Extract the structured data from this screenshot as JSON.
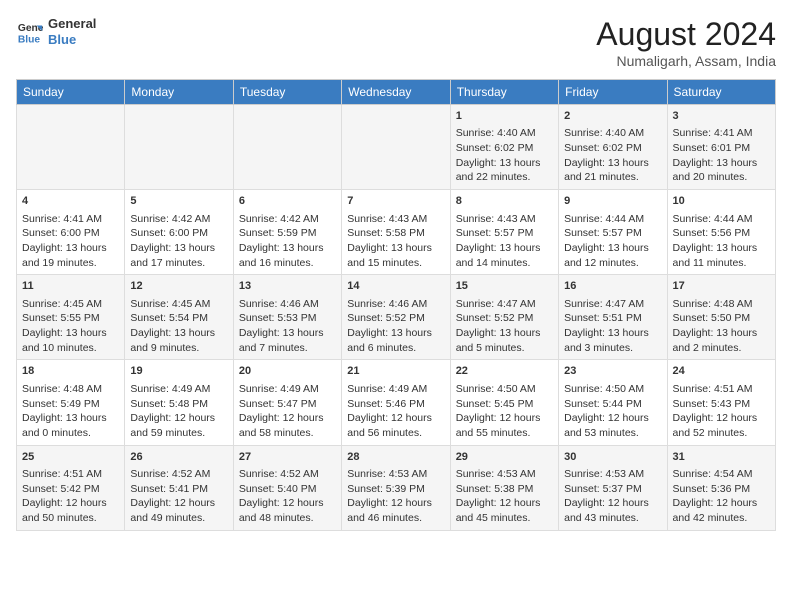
{
  "header": {
    "logo_line1": "General",
    "logo_line2": "Blue",
    "main_title": "August 2024",
    "sub_title": "Numaligarh, Assam, India"
  },
  "calendar": {
    "headers": [
      "Sunday",
      "Monday",
      "Tuesday",
      "Wednesday",
      "Thursday",
      "Friday",
      "Saturday"
    ],
    "rows": [
      [
        {
          "day": "",
          "info": ""
        },
        {
          "day": "",
          "info": ""
        },
        {
          "day": "",
          "info": ""
        },
        {
          "day": "",
          "info": ""
        },
        {
          "day": "1",
          "info": "Sunrise: 4:40 AM\nSunset: 6:02 PM\nDaylight: 13 hours\nand 22 minutes."
        },
        {
          "day": "2",
          "info": "Sunrise: 4:40 AM\nSunset: 6:02 PM\nDaylight: 13 hours\nand 21 minutes."
        },
        {
          "day": "3",
          "info": "Sunrise: 4:41 AM\nSunset: 6:01 PM\nDaylight: 13 hours\nand 20 minutes."
        }
      ],
      [
        {
          "day": "4",
          "info": "Sunrise: 4:41 AM\nSunset: 6:00 PM\nDaylight: 13 hours\nand 19 minutes."
        },
        {
          "day": "5",
          "info": "Sunrise: 4:42 AM\nSunset: 6:00 PM\nDaylight: 13 hours\nand 17 minutes."
        },
        {
          "day": "6",
          "info": "Sunrise: 4:42 AM\nSunset: 5:59 PM\nDaylight: 13 hours\nand 16 minutes."
        },
        {
          "day": "7",
          "info": "Sunrise: 4:43 AM\nSunset: 5:58 PM\nDaylight: 13 hours\nand 15 minutes."
        },
        {
          "day": "8",
          "info": "Sunrise: 4:43 AM\nSunset: 5:57 PM\nDaylight: 13 hours\nand 14 minutes."
        },
        {
          "day": "9",
          "info": "Sunrise: 4:44 AM\nSunset: 5:57 PM\nDaylight: 13 hours\nand 12 minutes."
        },
        {
          "day": "10",
          "info": "Sunrise: 4:44 AM\nSunset: 5:56 PM\nDaylight: 13 hours\nand 11 minutes."
        }
      ],
      [
        {
          "day": "11",
          "info": "Sunrise: 4:45 AM\nSunset: 5:55 PM\nDaylight: 13 hours\nand 10 minutes."
        },
        {
          "day": "12",
          "info": "Sunrise: 4:45 AM\nSunset: 5:54 PM\nDaylight: 13 hours\nand 9 minutes."
        },
        {
          "day": "13",
          "info": "Sunrise: 4:46 AM\nSunset: 5:53 PM\nDaylight: 13 hours\nand 7 minutes."
        },
        {
          "day": "14",
          "info": "Sunrise: 4:46 AM\nSunset: 5:52 PM\nDaylight: 13 hours\nand 6 minutes."
        },
        {
          "day": "15",
          "info": "Sunrise: 4:47 AM\nSunset: 5:52 PM\nDaylight: 13 hours\nand 5 minutes."
        },
        {
          "day": "16",
          "info": "Sunrise: 4:47 AM\nSunset: 5:51 PM\nDaylight: 13 hours\nand 3 minutes."
        },
        {
          "day": "17",
          "info": "Sunrise: 4:48 AM\nSunset: 5:50 PM\nDaylight: 13 hours\nand 2 minutes."
        }
      ],
      [
        {
          "day": "18",
          "info": "Sunrise: 4:48 AM\nSunset: 5:49 PM\nDaylight: 13 hours\nand 0 minutes."
        },
        {
          "day": "19",
          "info": "Sunrise: 4:49 AM\nSunset: 5:48 PM\nDaylight: 12 hours\nand 59 minutes."
        },
        {
          "day": "20",
          "info": "Sunrise: 4:49 AM\nSunset: 5:47 PM\nDaylight: 12 hours\nand 58 minutes."
        },
        {
          "day": "21",
          "info": "Sunrise: 4:49 AM\nSunset: 5:46 PM\nDaylight: 12 hours\nand 56 minutes."
        },
        {
          "day": "22",
          "info": "Sunrise: 4:50 AM\nSunset: 5:45 PM\nDaylight: 12 hours\nand 55 minutes."
        },
        {
          "day": "23",
          "info": "Sunrise: 4:50 AM\nSunset: 5:44 PM\nDaylight: 12 hours\nand 53 minutes."
        },
        {
          "day": "24",
          "info": "Sunrise: 4:51 AM\nSunset: 5:43 PM\nDaylight: 12 hours\nand 52 minutes."
        }
      ],
      [
        {
          "day": "25",
          "info": "Sunrise: 4:51 AM\nSunset: 5:42 PM\nDaylight: 12 hours\nand 50 minutes."
        },
        {
          "day": "26",
          "info": "Sunrise: 4:52 AM\nSunset: 5:41 PM\nDaylight: 12 hours\nand 49 minutes."
        },
        {
          "day": "27",
          "info": "Sunrise: 4:52 AM\nSunset: 5:40 PM\nDaylight: 12 hours\nand 48 minutes."
        },
        {
          "day": "28",
          "info": "Sunrise: 4:53 AM\nSunset: 5:39 PM\nDaylight: 12 hours\nand 46 minutes."
        },
        {
          "day": "29",
          "info": "Sunrise: 4:53 AM\nSunset: 5:38 PM\nDaylight: 12 hours\nand 45 minutes."
        },
        {
          "day": "30",
          "info": "Sunrise: 4:53 AM\nSunset: 5:37 PM\nDaylight: 12 hours\nand 43 minutes."
        },
        {
          "day": "31",
          "info": "Sunrise: 4:54 AM\nSunset: 5:36 PM\nDaylight: 12 hours\nand 42 minutes."
        }
      ]
    ]
  }
}
